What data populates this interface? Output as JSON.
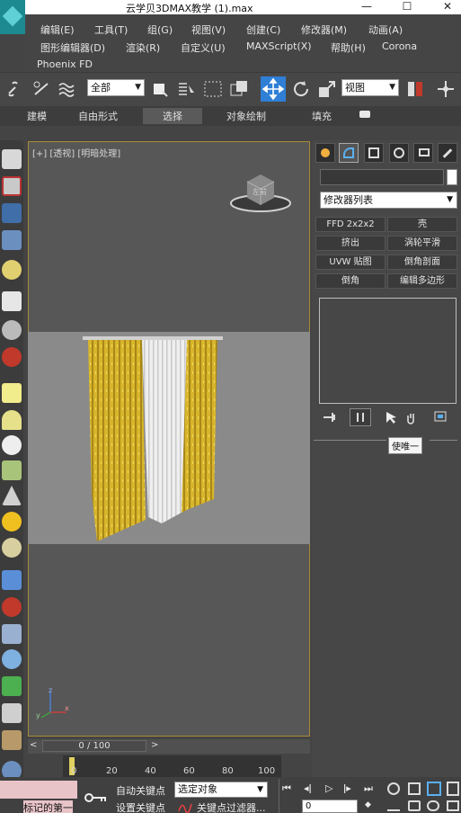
{
  "window": {
    "title": "云学贝3DMAX教学 (1).max",
    "minimize": "—",
    "maximize": "☐",
    "close": "✕"
  },
  "menu": {
    "row1": [
      "编辑(E)",
      "工具(T)",
      "组(G)",
      "视图(V)",
      "创建(C)",
      "修改器(M)",
      "动画(A)"
    ],
    "row2": [
      "图形编辑器(D)",
      "渲染(R)",
      "自定义(U)",
      "MAXScript(X)",
      "帮助(H)",
      "Corona"
    ],
    "row3": [
      "Phoenix FD"
    ]
  },
  "toolbar": {
    "selection_filter": "全部",
    "coord_system": "视图"
  },
  "ribbon": {
    "tabs": [
      "建模",
      "自由形式",
      "选择",
      "对象绘制",
      "填充"
    ],
    "active": "选择"
  },
  "viewport": {
    "label": "[+] [透视] [明暗处理]",
    "viewcube_label": "左前",
    "axis": {
      "x": "x",
      "y": "y",
      "z": "z"
    }
  },
  "command_panel": {
    "modifier_list": "修改器列表",
    "modifiers": [
      [
        "FFD 2x2x2",
        "壳"
      ],
      [
        "挤出",
        "涡轮平滑"
      ],
      [
        "UVW 贴图",
        "倒角剖面"
      ],
      [
        "倒角",
        "编辑多边形"
      ]
    ],
    "tooltip": "使唯一"
  },
  "timeline": {
    "frame_display": "0 / 100",
    "prev": "<",
    "next": ">",
    "ticks": [
      "0",
      "20",
      "40",
      "60",
      "80",
      "100"
    ]
  },
  "status": {
    "auto_key": "自动关键点",
    "set_key": "设置关键点",
    "selected_object": "选定对象",
    "key_filter": "关键点过滤器...",
    "frame_input": "0",
    "marker_label": "标记的第一"
  },
  "colors": {
    "viewport_border": "#a88b3a",
    "curtain_yellow": "#d8b52a",
    "curtain_white": "#efefef",
    "accent_blue": "#2f7fd6"
  }
}
